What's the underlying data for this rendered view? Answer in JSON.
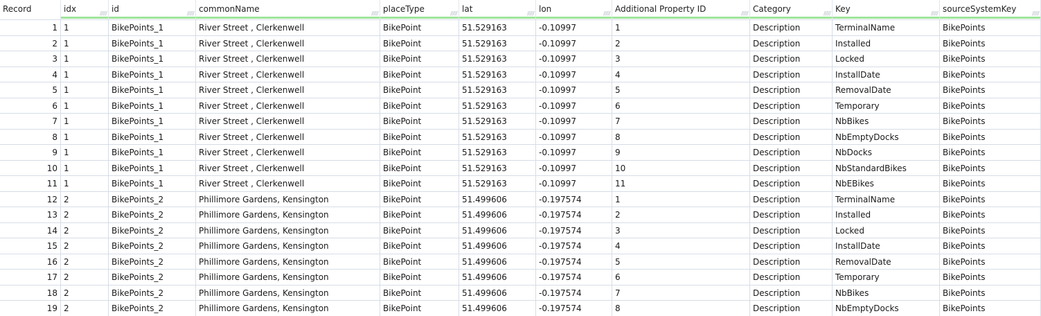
{
  "columns": [
    "Record",
    "idx",
    "id",
    "commonName",
    "placeType",
    "lat",
    "lon",
    "Additional Property ID",
    "Category",
    "Key",
    "sourceSystemKey"
  ],
  "rows": [
    [
      "1",
      "1",
      "BikePoints_1",
      "River Street , Clerkenwell",
      "BikePoint",
      "51.529163",
      "-0.10997",
      "1",
      "Description",
      "TerminalName",
      "BikePoints"
    ],
    [
      "2",
      "1",
      "BikePoints_1",
      "River Street , Clerkenwell",
      "BikePoint",
      "51.529163",
      "-0.10997",
      "2",
      "Description",
      "Installed",
      "BikePoints"
    ],
    [
      "3",
      "1",
      "BikePoints_1",
      "River Street , Clerkenwell",
      "BikePoint",
      "51.529163",
      "-0.10997",
      "3",
      "Description",
      "Locked",
      "BikePoints"
    ],
    [
      "4",
      "1",
      "BikePoints_1",
      "River Street , Clerkenwell",
      "BikePoint",
      "51.529163",
      "-0.10997",
      "4",
      "Description",
      "InstallDate",
      "BikePoints"
    ],
    [
      "5",
      "1",
      "BikePoints_1",
      "River Street , Clerkenwell",
      "BikePoint",
      "51.529163",
      "-0.10997",
      "5",
      "Description",
      "RemovalDate",
      "BikePoints"
    ],
    [
      "6",
      "1",
      "BikePoints_1",
      "River Street , Clerkenwell",
      "BikePoint",
      "51.529163",
      "-0.10997",
      "6",
      "Description",
      "Temporary",
      "BikePoints"
    ],
    [
      "7",
      "1",
      "BikePoints_1",
      "River Street , Clerkenwell",
      "BikePoint",
      "51.529163",
      "-0.10997",
      "7",
      "Description",
      "NbBikes",
      "BikePoints"
    ],
    [
      "8",
      "1",
      "BikePoints_1",
      "River Street , Clerkenwell",
      "BikePoint",
      "51.529163",
      "-0.10997",
      "8",
      "Description",
      "NbEmptyDocks",
      "BikePoints"
    ],
    [
      "9",
      "1",
      "BikePoints_1",
      "River Street , Clerkenwell",
      "BikePoint",
      "51.529163",
      "-0.10997",
      "9",
      "Description",
      "NbDocks",
      "BikePoints"
    ],
    [
      "10",
      "1",
      "BikePoints_1",
      "River Street , Clerkenwell",
      "BikePoint",
      "51.529163",
      "-0.10997",
      "10",
      "Description",
      "NbStandardBikes",
      "BikePoints"
    ],
    [
      "11",
      "1",
      "BikePoints_1",
      "River Street , Clerkenwell",
      "BikePoint",
      "51.529163",
      "-0.10997",
      "11",
      "Description",
      "NbEBikes",
      "BikePoints"
    ],
    [
      "12",
      "2",
      "BikePoints_2",
      "Phillimore Gardens, Kensington",
      "BikePoint",
      "51.499606",
      "-0.197574",
      "1",
      "Description",
      "TerminalName",
      "BikePoints"
    ],
    [
      "13",
      "2",
      "BikePoints_2",
      "Phillimore Gardens, Kensington",
      "BikePoint",
      "51.499606",
      "-0.197574",
      "2",
      "Description",
      "Installed",
      "BikePoints"
    ],
    [
      "14",
      "2",
      "BikePoints_2",
      "Phillimore Gardens, Kensington",
      "BikePoint",
      "51.499606",
      "-0.197574",
      "3",
      "Description",
      "Locked",
      "BikePoints"
    ],
    [
      "15",
      "2",
      "BikePoints_2",
      "Phillimore Gardens, Kensington",
      "BikePoint",
      "51.499606",
      "-0.197574",
      "4",
      "Description",
      "InstallDate",
      "BikePoints"
    ],
    [
      "16",
      "2",
      "BikePoints_2",
      "Phillimore Gardens, Kensington",
      "BikePoint",
      "51.499606",
      "-0.197574",
      "5",
      "Description",
      "RemovalDate",
      "BikePoints"
    ],
    [
      "17",
      "2",
      "BikePoints_2",
      "Phillimore Gardens, Kensington",
      "BikePoint",
      "51.499606",
      "-0.197574",
      "6",
      "Description",
      "Temporary",
      "BikePoints"
    ],
    [
      "18",
      "2",
      "BikePoints_2",
      "Phillimore Gardens, Kensington",
      "BikePoint",
      "51.499606",
      "-0.197574",
      "7",
      "Description",
      "NbBikes",
      "BikePoints"
    ],
    [
      "19",
      "2",
      "BikePoints_2",
      "Phillimore Gardens, Kensington",
      "BikePoint",
      "51.499606",
      "-0.197574",
      "8",
      "Description",
      "NbEmptyDocks",
      "BikePoints"
    ]
  ]
}
